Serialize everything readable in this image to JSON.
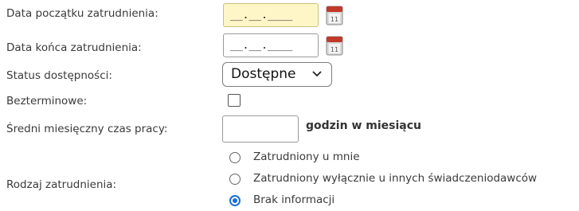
{
  "form": {
    "start_date": {
      "label": "Data początku zatrudnienia:",
      "value": "__.__.____"
    },
    "end_date": {
      "label": "Data końca zatrudnienia:",
      "value": "__.__.____"
    },
    "availability": {
      "label": "Status dostępności:",
      "selected": "Dostępne"
    },
    "indefinite": {
      "label": "Bezterminowe:",
      "checked": false
    },
    "avg_hours": {
      "label": "Średni miesięczny czas pracy:",
      "value": "",
      "unit": "godzin w miesiącu"
    },
    "employment_type": {
      "label": "Rodzaj zatrudnienia:",
      "options": [
        {
          "label": "Zatrudniony u mnie",
          "checked": false
        },
        {
          "label": "Zatrudniony wyłącznie u innych świadczeniodawców",
          "checked": false
        },
        {
          "label": "Brak informacji",
          "checked": true
        }
      ]
    }
  },
  "icons": {
    "calendar": "calendar-icon",
    "chevron": "chevron-down-icon"
  },
  "colors": {
    "active_field": "#fff6c8",
    "radio_selected": "#1a6fd6",
    "calendar_red": "#c0392b"
  }
}
